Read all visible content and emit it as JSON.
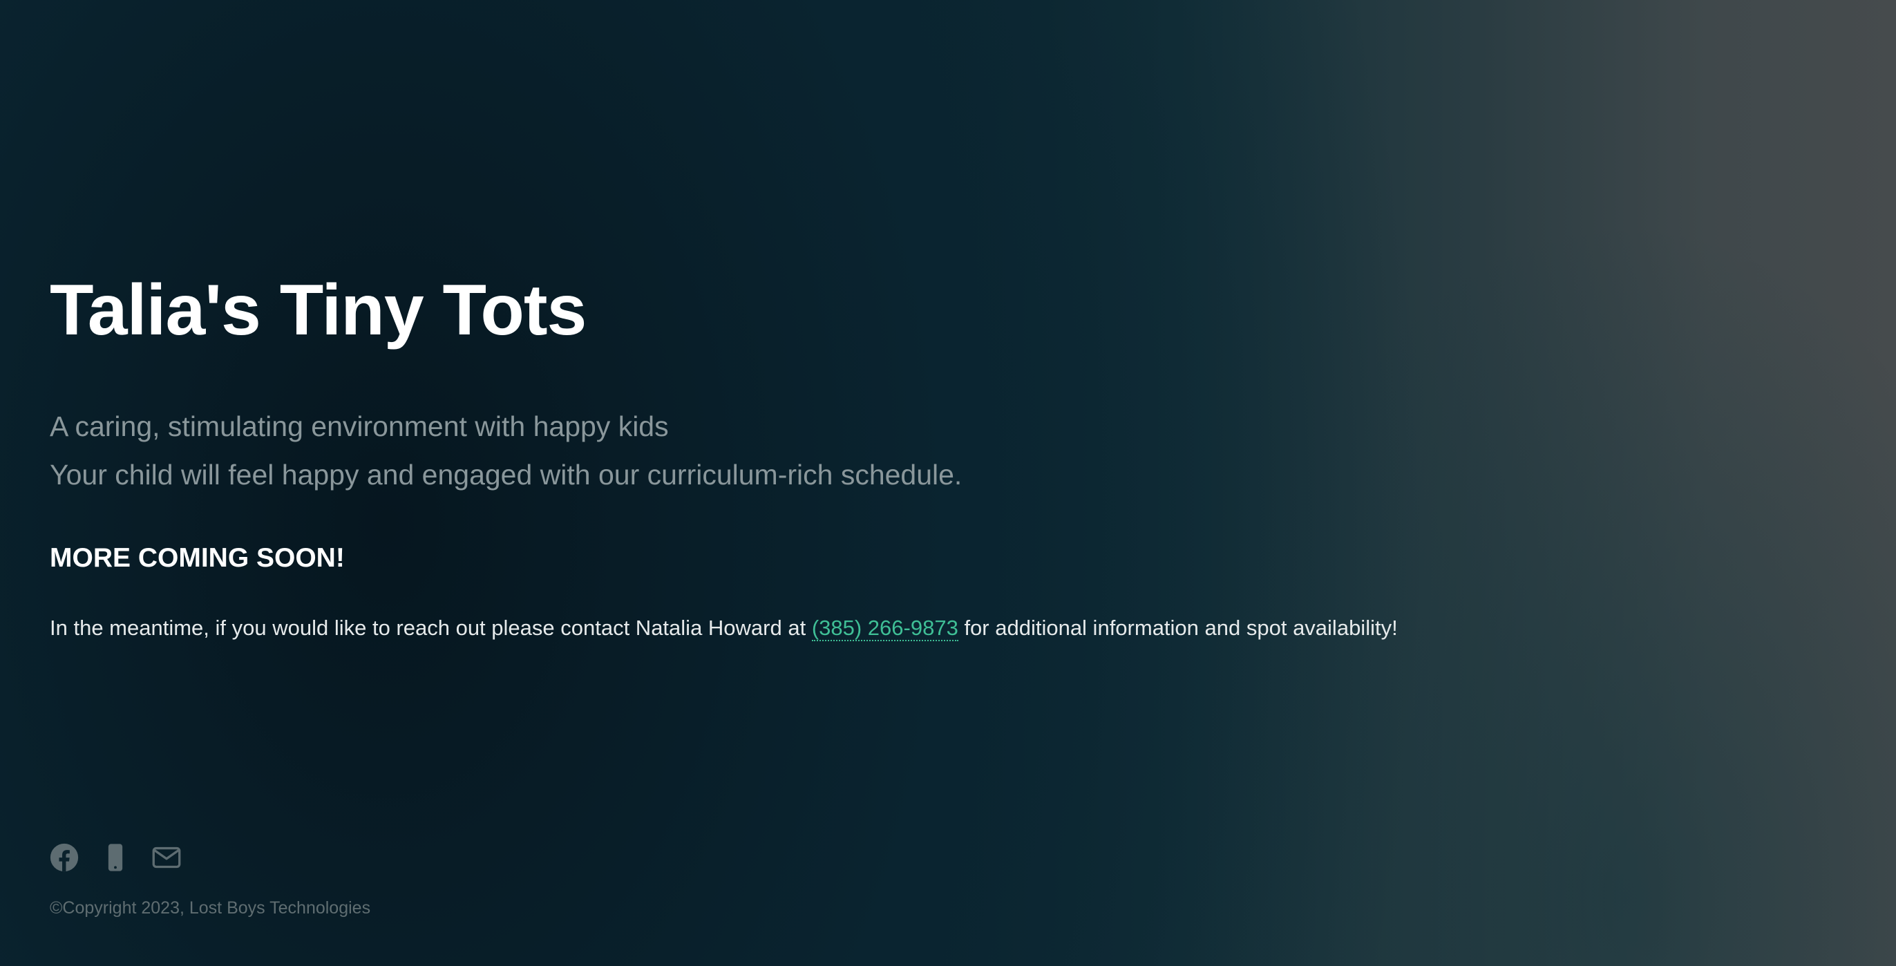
{
  "header": {
    "title": "Talia's Tiny Tots"
  },
  "intro": {
    "line1": "A caring, stimulating environment with happy kids",
    "line2": "Your child will feel happy and engaged with our curriculum-rich schedule."
  },
  "announcement": {
    "heading": "MORE COMING SOON!",
    "text_before": "In the meantime, if you would like to reach out please contact Natalia Howard at ",
    "phone": "(385) 266-9873",
    "text_after": " for additional information and spot availability!"
  },
  "footer": {
    "icons": [
      "facebook-icon",
      "phone-icon",
      "email-icon"
    ],
    "copyright": "©Copyright 2023, Lost Boys Technologies"
  },
  "colors": {
    "background": "#0b222c",
    "accent": "#3fbf96",
    "muted_text": "#8a979b",
    "icon": "#5d6c71"
  }
}
